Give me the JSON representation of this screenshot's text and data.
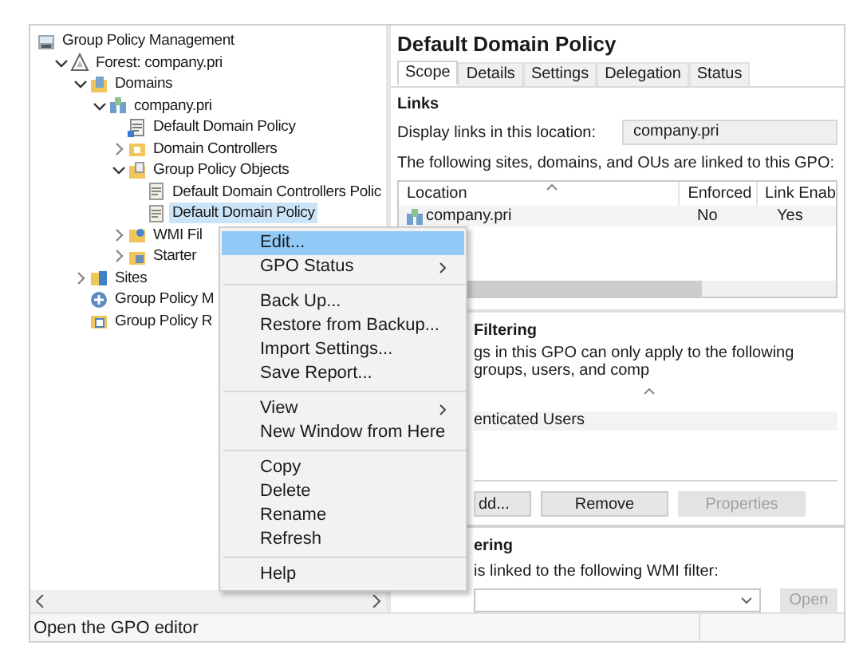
{
  "tree": [
    {
      "label": "Group Policy Management",
      "kind": "console",
      "selected": false,
      "children": [
        {
          "label": "Forest: company.pri",
          "kind": "forest",
          "expanded": true,
          "selected": false,
          "children": [
            {
              "label": "Domains",
              "kind": "domains",
              "expanded": true,
              "selected": false,
              "children": [
                {
                  "label": "company.pri",
                  "kind": "domain",
                  "expanded": true,
                  "selected": false,
                  "children": [
                    {
                      "label": "Default Domain Policy",
                      "kind": "gpo-link",
                      "selected": false
                    },
                    {
                      "label": "Domain Controllers",
                      "kind": "ou",
                      "expanded": false,
                      "selected": false
                    },
                    {
                      "label": "Group Policy Objects",
                      "kind": "folder",
                      "expanded": true,
                      "selected": false,
                      "children": [
                        {
                          "label": "Default Domain Controllers Polic",
                          "kind": "gpo",
                          "selected": false
                        },
                        {
                          "label": "Default Domain Policy",
                          "kind": "gpo",
                          "selected": true
                        }
                      ]
                    },
                    {
                      "label": "WMI Fil",
                      "kind": "wmi",
                      "expanded": false,
                      "selected": false
                    },
                    {
                      "label": "Starter",
                      "kind": "starter",
                      "expanded": false,
                      "selected": false
                    }
                  ]
                }
              ]
            },
            {
              "label": "Sites",
              "kind": "sites",
              "expanded": false,
              "selected": false
            },
            {
              "label": "Group Policy M",
              "kind": "modeling",
              "selected": false
            },
            {
              "label": "Group Policy R",
              "kind": "results",
              "selected": false
            }
          ]
        }
      ]
    }
  ],
  "status_bar": "Open the GPO editor",
  "details": {
    "title": "Default Domain Policy",
    "tabs": [
      {
        "label": "Scope",
        "selected": true
      },
      {
        "label": "Details",
        "selected": false
      },
      {
        "label": "Settings",
        "selected": false
      },
      {
        "label": "Delegation",
        "selected": false
      },
      {
        "label": "Status",
        "selected": false
      }
    ],
    "links": {
      "heading": "Links",
      "location_label": "Display links in this location:",
      "location_value": "company.pri",
      "description": "The following sites, domains, and OUs are linked to this GPO:",
      "columns": [
        "Location",
        "Enforced",
        "Link Enab"
      ],
      "rows": [
        [
          "company.pri",
          "No",
          "Yes"
        ]
      ]
    },
    "security_filtering": {
      "heading": "Filtering",
      "description": "gs in this GPO can only apply to the following groups, users, and comp",
      "rows": [
        "enticated Users"
      ],
      "buttons": [
        {
          "label": "dd...",
          "disabled": false
        },
        {
          "label": "Remove",
          "disabled": false
        },
        {
          "label": "Properties",
          "disabled": true
        }
      ]
    },
    "wmi_filtering": {
      "heading": "ering",
      "description": "is linked to the following WMI filter:",
      "open_button": {
        "label": "Open",
        "disabled": true
      }
    }
  },
  "context_menu": [
    {
      "kind": "item",
      "label": "Edit...",
      "selected": true,
      "submenu": false
    },
    {
      "kind": "item",
      "label": "GPO Status",
      "selected": false,
      "submenu": true
    },
    {
      "kind": "separator"
    },
    {
      "kind": "item",
      "label": "Back Up...",
      "selected": false,
      "submenu": false
    },
    {
      "kind": "item",
      "label": "Restore from Backup...",
      "selected": false,
      "submenu": false
    },
    {
      "kind": "item",
      "label": "Import Settings...",
      "selected": false,
      "submenu": false
    },
    {
      "kind": "item",
      "label": "Save Report...",
      "selected": false,
      "submenu": false
    },
    {
      "kind": "separator"
    },
    {
      "kind": "item",
      "label": "View",
      "selected": false,
      "submenu": true
    },
    {
      "kind": "item",
      "label": "New Window from Here",
      "selected": false,
      "submenu": false
    },
    {
      "kind": "separator"
    },
    {
      "kind": "item",
      "label": "Copy",
      "selected": false,
      "submenu": false
    },
    {
      "kind": "item",
      "label": "Delete",
      "selected": false,
      "submenu": false
    },
    {
      "kind": "item",
      "label": "Rename",
      "selected": false,
      "submenu": false
    },
    {
      "kind": "item",
      "label": "Refresh",
      "selected": false,
      "submenu": false
    },
    {
      "kind": "separator"
    },
    {
      "kind": "item",
      "label": "Help",
      "selected": false,
      "submenu": false
    }
  ]
}
